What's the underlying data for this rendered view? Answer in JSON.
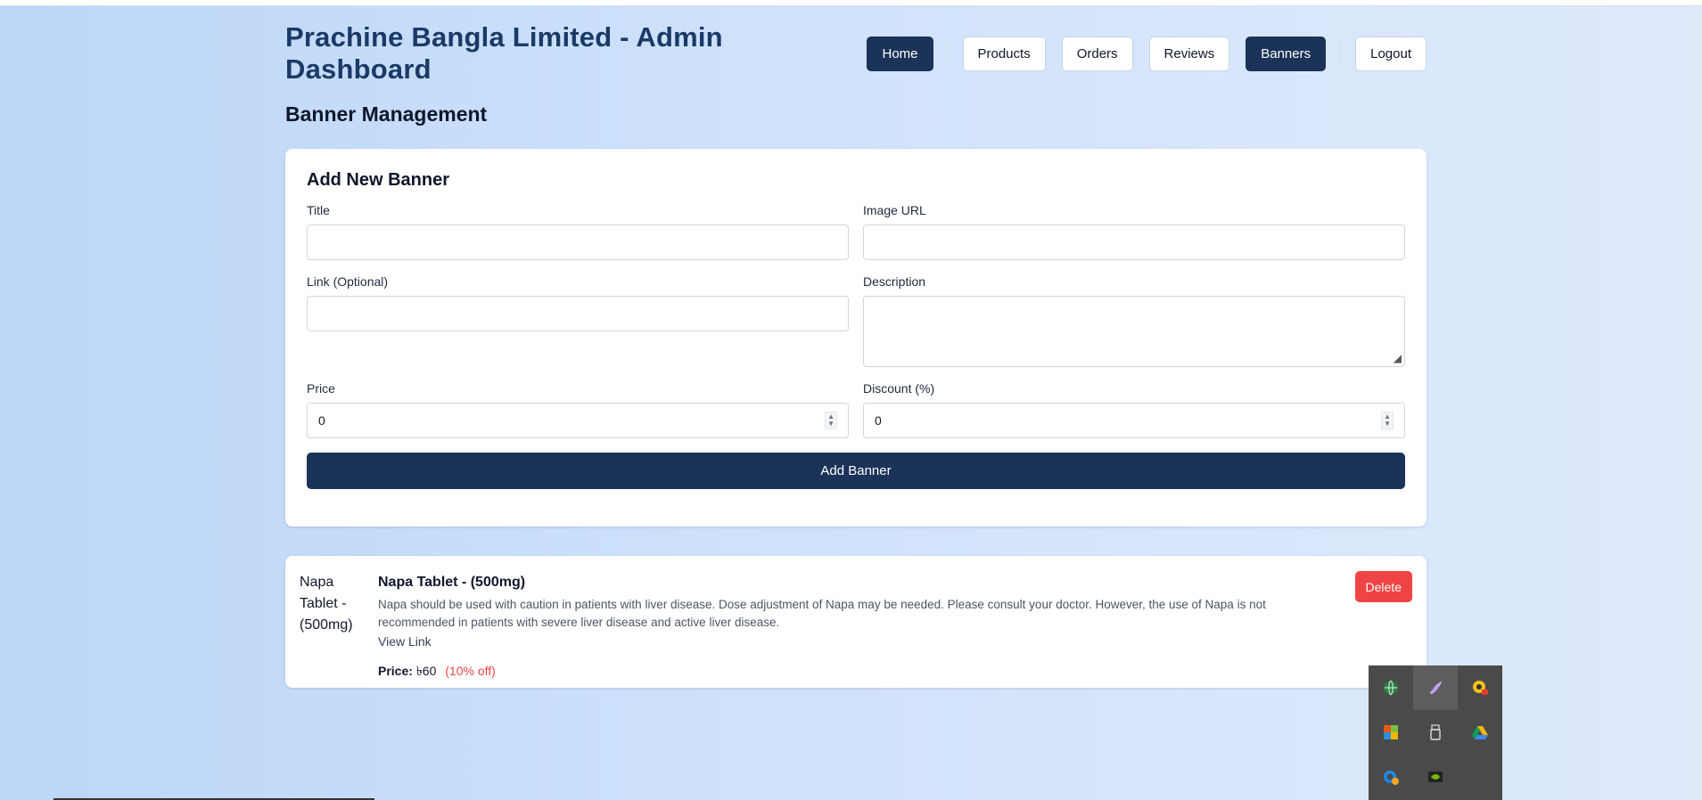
{
  "header": {
    "title": "Prachine Bangla Limited - Admin Dashboard",
    "nav": {
      "home": "Home",
      "products": "Products",
      "orders": "Orders",
      "reviews": "Reviews",
      "banners": "Banners",
      "logout": "Logout"
    }
  },
  "page": {
    "title": "Banner Management"
  },
  "form": {
    "heading": "Add New Banner",
    "title_label": "Title",
    "image_url_label": "Image URL",
    "link_label": "Link (Optional)",
    "description_label": "Description",
    "price_label": "Price",
    "price_value": "0",
    "discount_label": "Discount (%)",
    "discount_value": "0",
    "submit_label": "Add Banner"
  },
  "banners": [
    {
      "image_alt": "Napa Tablet - (500mg)",
      "title": "Napa Tablet - (500mg)",
      "description": "Napa should be used with caution in patients with liver disease. Dose adjustment of Napa may be needed. Please consult your doctor. However, the use of Napa is not recommended in patients with severe liver disease and active liver disease.",
      "link_label": "View Link",
      "price_label": "Price:",
      "price_value": "৳60",
      "discount_text": "(10% off)",
      "delete_label": "Delete"
    }
  ],
  "tray": {
    "icons": [
      "globe-icon",
      "feather-icon",
      "lock-badge-icon",
      "office-icon",
      "usb-drive-icon",
      "google-drive-icon",
      "onedrive-sync-icon",
      "nvidia-icon"
    ]
  },
  "colors": {
    "primary": "#1b3358",
    "title_blue": "#1b3a68",
    "danger": "#ef4444"
  }
}
